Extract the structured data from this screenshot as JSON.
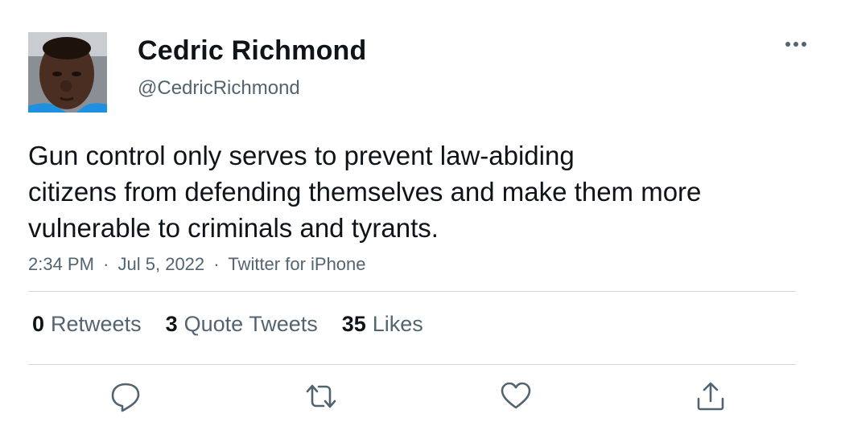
{
  "user": {
    "display_name": "Cedric Richmond",
    "handle": "@CedricRichmond",
    "avatar_icon": "profile-photo"
  },
  "tweet": {
    "text_lines": [
      "Gun control only serves to prevent law-abiding",
      "citizens from defending themselves and make them more",
      "vulnerable to criminals and tyrants."
    ],
    "time": "2:34 PM",
    "date": "Jul 5, 2022",
    "source": "Twitter for iPhone",
    "separator": "·"
  },
  "stats": {
    "retweets": {
      "count": "0",
      "label": "Retweets"
    },
    "quote_tweets": {
      "count": "3",
      "label": "Quote Tweets"
    },
    "likes": {
      "count": "35",
      "label": "Likes"
    }
  },
  "actions": [
    "reply-icon",
    "retweet-icon",
    "like-icon",
    "share-icon"
  ],
  "colors": {
    "text_primary": "#0f1419",
    "text_secondary": "#536471",
    "divider": "#cfd9de"
  }
}
